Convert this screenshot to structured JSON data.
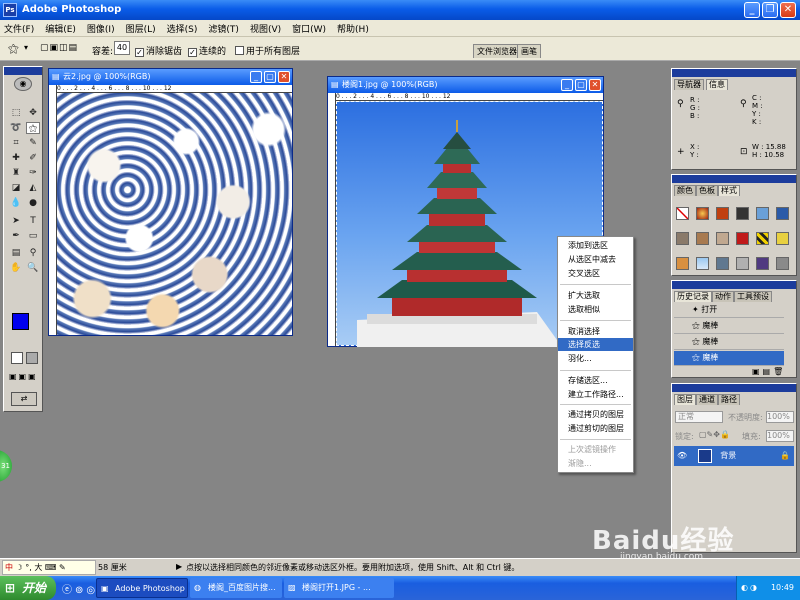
{
  "app": {
    "title": "Adobe Photoshop"
  },
  "menu": [
    "文件(F)",
    "编辑(E)",
    "图像(I)",
    "图层(L)",
    "选择(S)",
    "滤镜(T)",
    "视图(V)",
    "窗口(W)",
    "帮助(H)"
  ],
  "options": {
    "tolerance_label": "容差:",
    "tolerance_value": "40",
    "antialias": "消除锯齿",
    "contiguous": "连续的",
    "all_layers": "用于所有图层",
    "tab_browser": "文件浏览器",
    "tab_brushes": "画笔"
  },
  "docs": [
    {
      "title": "云2.jpg @ 100%(RGB)",
      "ruler": "0 . . . 2 . . . 4 . . . 6 . . . 8 . . . 10 . . . 12"
    },
    {
      "title": "楼阁1.jpg @ 100%(RGB)",
      "ruler": "0 . . . 2 . . . 4 . . . 6 . . . 8 . . . 10 . . . 12"
    }
  ],
  "context_menu": [
    {
      "label": "添加到选区",
      "state": "normal"
    },
    {
      "label": "从选区中减去",
      "state": "normal"
    },
    {
      "label": "交叉选区",
      "state": "normal"
    },
    {
      "label": "扩大选取",
      "state": "normal"
    },
    {
      "label": "选取相似",
      "state": "normal"
    },
    {
      "label": "取消选择",
      "state": "normal"
    },
    {
      "label": "选择反选",
      "state": "highlighted"
    },
    {
      "label": "羽化...",
      "state": "normal"
    },
    {
      "label": "存储选区...",
      "state": "normal"
    },
    {
      "label": "建立工作路径...",
      "state": "normal"
    },
    {
      "label": "通过拷贝的图层",
      "state": "normal"
    },
    {
      "label": "通过剪切的图层",
      "state": "normal"
    },
    {
      "label": "上次滤镜操作",
      "state": "disabled"
    },
    {
      "label": "渐隐...",
      "state": "disabled"
    }
  ],
  "navigator": {
    "tabs": [
      "导航器",
      "信息"
    ],
    "r": "R :",
    "g": "G :",
    "b": "B :",
    "c": "C :",
    "m": "M :",
    "y": "Y :",
    "k": "K :",
    "x": "X :",
    "yy": "Y :",
    "w": "W :",
    "h": "H :",
    "w_val": "15.88",
    "h_val": "10.58"
  },
  "swatches": {
    "tabs": [
      "颜色",
      "色板",
      "样式"
    ]
  },
  "history": {
    "tabs": [
      "历史记录",
      "动作",
      "工具预设"
    ],
    "items": [
      {
        "label": "打开",
        "selected": false
      },
      {
        "label": "魔棒",
        "selected": false
      },
      {
        "label": "魔棒",
        "selected": false
      },
      {
        "label": "魔棒",
        "selected": true
      }
    ]
  },
  "layers": {
    "tabs": [
      "图层",
      "通道",
      "路径"
    ],
    "mode": "正常",
    "opacity_label": "不透明度:",
    "opacity": "100%",
    "lock_label": "锁定:",
    "fill_label": "填充:",
    "fill": "100%",
    "layer_name": "背景"
  },
  "status": {
    "zoom": "58 厘米",
    "hint": "点按以选择相同颜色的邻近像素或移动选区外框。要用附加选项，使用 Shift、Alt 和 Ctrl 键。"
  },
  "taskbar": {
    "start": "开始",
    "tasks": [
      "Adobe Photoshop",
      "楼阁_百度图片搜...",
      "楼阁打开1.JPG - ..."
    ],
    "time": "10:49",
    "ime": "中",
    "ime_extra": "大"
  },
  "watermark": {
    "text": "Baidu经验",
    "url": "jingyan.baidu.com"
  },
  "float_badge": "31",
  "colors": {
    "foreground": "#0000ee",
    "background": "#ffffff",
    "xp_blue": "#0c5be8",
    "highlight": "#316ac5"
  }
}
